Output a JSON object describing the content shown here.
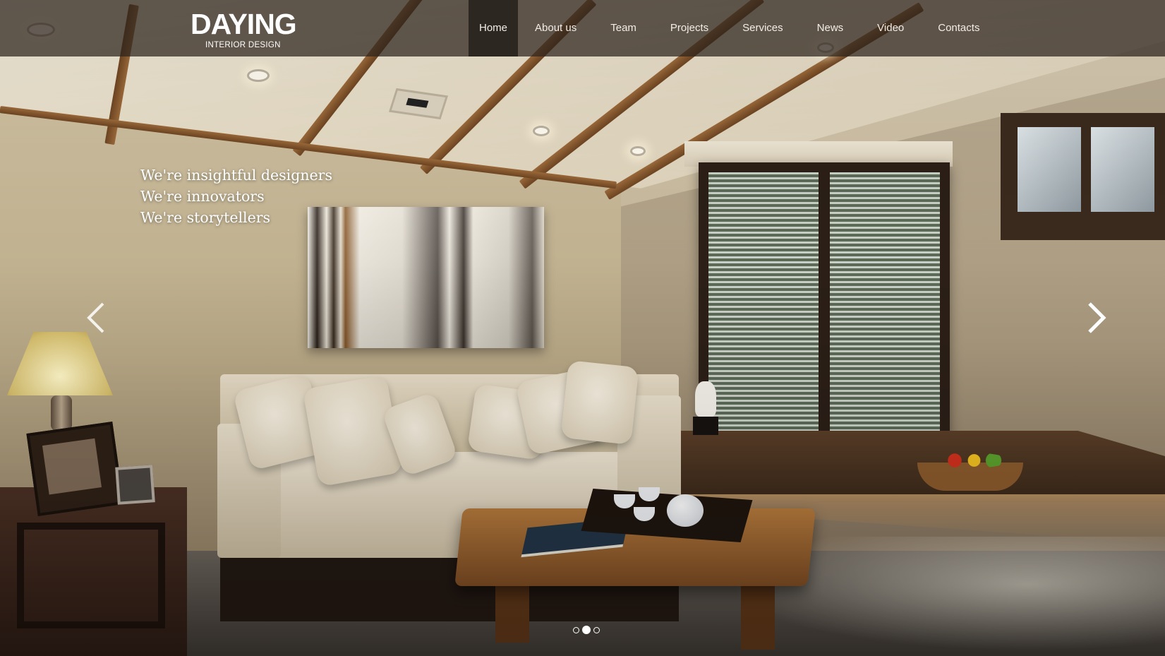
{
  "brand": {
    "name": "DAYING",
    "tagline": "INTERIOR DESIGN"
  },
  "nav": {
    "items": [
      {
        "label": "Home",
        "active": true
      },
      {
        "label": "About us",
        "active": false
      },
      {
        "label": "Team",
        "active": false
      },
      {
        "label": "Projects",
        "active": false
      },
      {
        "label": "Services",
        "active": false
      },
      {
        "label": "News",
        "active": false
      },
      {
        "label": "Video",
        "active": false
      },
      {
        "label": "Contacts",
        "active": false
      }
    ]
  },
  "slider": {
    "lines": [
      "We're insightful designers",
      "We're innovators",
      "We're storytellers"
    ],
    "prev_icon": "chevron-left-icon",
    "next_icon": "chevron-right-icon",
    "slide_count": 3,
    "active_slide": 2
  },
  "colors": {
    "nav_bg": "#2d231c",
    "text": "#ffffff",
    "active_bg": "#1e1814"
  }
}
